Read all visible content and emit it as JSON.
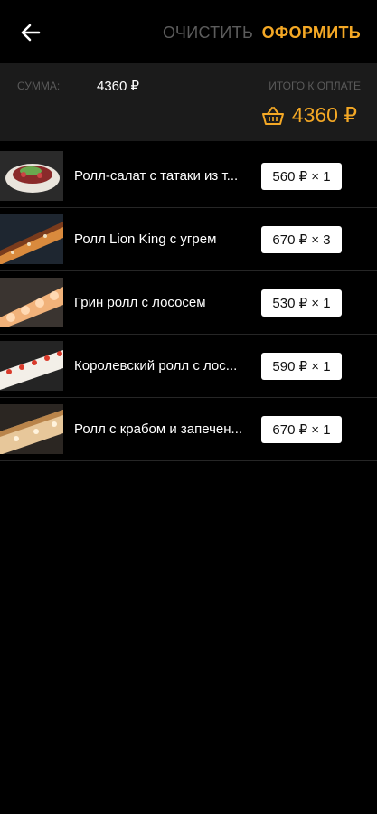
{
  "colors": {
    "accent": "#f4a825",
    "background": "#000000",
    "panel": "#1b1b1b",
    "muted": "#5c5c5c"
  },
  "header": {
    "back_icon": "arrow-left-icon",
    "clear_label": "ОЧИСТИТЬ",
    "checkout_label": "ОФОРМИТЬ"
  },
  "summary": {
    "sum_label": "СУММА:",
    "sum_value": "4360 ₽",
    "total_label": "ИТОГО К ОПЛАТЕ",
    "total_icon": "basket-icon",
    "total_value": "4360 ₽"
  },
  "items": [
    {
      "name": "Ролл-салат с татаки из т...",
      "qty": "560 ₽ × 1"
    },
    {
      "name": "Ролл Lion King с угрем",
      "qty": "670 ₽ × 3"
    },
    {
      "name": "Грин ролл с лососем",
      "qty": "530 ₽ × 1"
    },
    {
      "name": "Королевский ролл с лос...",
      "qty": "590 ₽ × 1"
    },
    {
      "name": "Ролл с крабом и запечен...",
      "qty": "670 ₽ × 1"
    }
  ]
}
